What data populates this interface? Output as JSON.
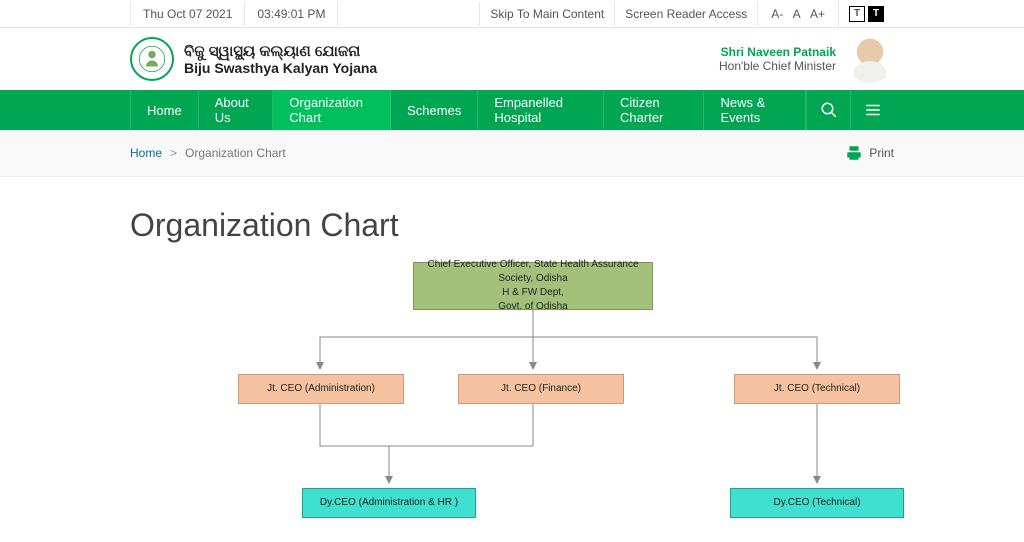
{
  "topbar": {
    "date": "Thu Oct 07 2021",
    "time": "03:49:01 PM",
    "skip": "Skip To Main Content",
    "reader": "Screen Reader Access",
    "aMinus": "A-",
    "aNorm": "A",
    "aPlus": "A+",
    "t1": "T",
    "t2": "T"
  },
  "header": {
    "odia": "ବିଜୁ ସ୍ୱାସ୍ଥ୍ୟ କଲ୍ୟାଣ ଯୋଜନା",
    "eng": "Biju Swasthya Kalyan Yojana",
    "cmName": "Shri Naveen Patnaik",
    "cmDesig": "Hon'ble Chief Minister"
  },
  "nav": {
    "items": [
      "Home",
      "About Us",
      "Organization Chart",
      "Schemes",
      "Empanelled Hospital",
      "Citizen Charter",
      "News & Events"
    ]
  },
  "crumb": {
    "home": "Home",
    "sep": ">",
    "current": "Organization Chart",
    "print": "Print"
  },
  "page": {
    "title": "Organization Chart"
  },
  "chart": {
    "level1": "Chief Executive Officer, State Health Assurance Society, Odisha\nH & FW Dept,\nGovt. of Odisha",
    "level2": {
      "a": "Jt. CEO (Administration)",
      "b": "Jt. CEO (Finance)",
      "c": "Jt. CEO (Technical)"
    },
    "level3": {
      "a": "Dy.CEO (Administration & HR )",
      "b": "Dy.CEO (Technical)"
    }
  }
}
